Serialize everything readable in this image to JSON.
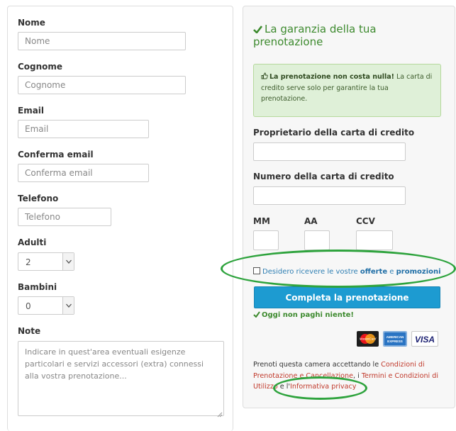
{
  "form": {
    "nome_label": "Nome",
    "nome_placeholder": "Nome",
    "cognome_label": "Cognome",
    "cognome_placeholder": "Cognome",
    "email_label": "Email",
    "email_placeholder": "Email",
    "conferma_label": "Conferma email",
    "conferma_placeholder": "Conferma email",
    "telefono_label": "Telefono",
    "telefono_placeholder": "Telefono",
    "adulti_label": "Adulti",
    "adulti_value": "2",
    "bambini_label": "Bambini",
    "bambini_value": "0",
    "note_label": "Note",
    "note_placeholder": "Indicare in quest'area eventuali esigenze particolari e servizi accessori (extra) connessi alla vostra prenotazione..."
  },
  "guarantee": {
    "title": "La garanzia della tua prenotazione",
    "info_bold": "La prenotazione non costa nulla!",
    "info_text": " La carta di credito serve solo per garantire la tua prenotazione."
  },
  "card": {
    "owner_label": "Proprietario della carta di credito",
    "number_label": "Numero della carta di credito",
    "mm_label": "MM",
    "aa_label": "AA",
    "ccv_label": "CCV"
  },
  "newsletter": {
    "text_prefix": "Desidero ricevere le vostre ",
    "offerte": "offerte",
    "e": " e ",
    "promozioni": "promozioni"
  },
  "cta": {
    "label": "Completa la prenotazione",
    "pay_nothing": "Oggi non paghi niente!"
  },
  "payment_cards": [
    "MasterCard",
    "American Express",
    "VISA"
  ],
  "terms": {
    "prefix": "Prenoti questa camera accettando le ",
    "link1": "Condizioni di Prenotazione e Cancellazione",
    "sep": ", i ",
    "link2": "Termini e Condizioni di Utilizzo",
    "mid": " e l'",
    "link3": "Informativa privacy"
  },
  "colors": {
    "accent_green": "#3d8a2e",
    "cta_blue": "#1d9bd1",
    "link_red": "#c0392b",
    "highlight_ellipse": "#2ea33d"
  }
}
